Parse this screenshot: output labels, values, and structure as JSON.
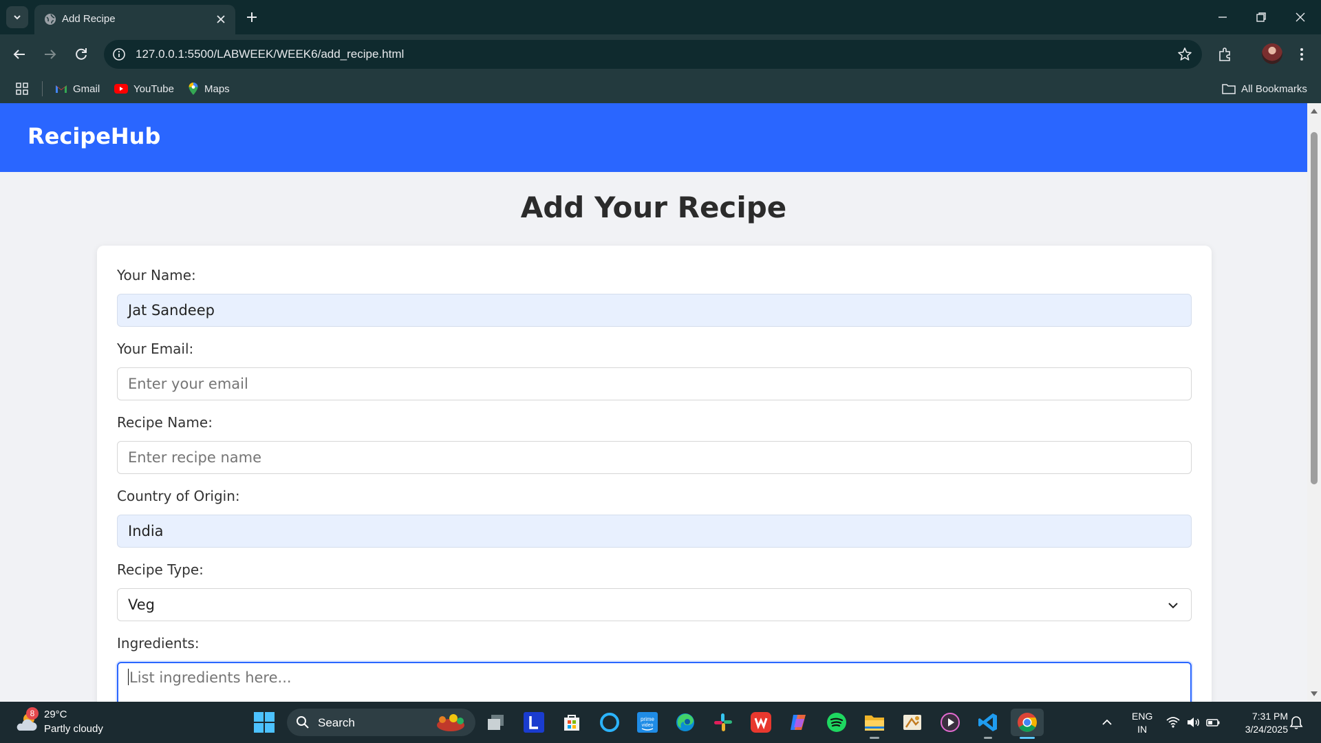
{
  "browser": {
    "tab_title": "Add Recipe",
    "url": "127.0.0.1:5500/LABWEEK/WEEK6/add_recipe.html",
    "bookmarks": [
      {
        "label": "Gmail",
        "icon": "gmail-icon"
      },
      {
        "label": "YouTube",
        "icon": "youtube-icon"
      },
      {
        "label": "Maps",
        "icon": "maps-icon"
      }
    ],
    "all_bookmarks_label": "All Bookmarks"
  },
  "site": {
    "brand": "RecipeHub",
    "page_title": "Add Your Recipe",
    "accent_color": "#2a66ff",
    "form": {
      "name": {
        "label": "Your Name:",
        "value": "Jat Sandeep"
      },
      "email": {
        "label": "Your Email:",
        "placeholder": "Enter your email"
      },
      "recipe_name": {
        "label": "Recipe Name:",
        "placeholder": "Enter recipe name"
      },
      "country": {
        "label": "Country of Origin:",
        "value": "India"
      },
      "recipe_type": {
        "label": "Recipe Type:",
        "value": "Veg"
      },
      "ingredients": {
        "label": "Ingredients:",
        "placeholder": "List ingredients here..."
      }
    }
  },
  "taskbar": {
    "weather": {
      "badge": "8",
      "temp": "29°C",
      "desc": "Partly cloudy"
    },
    "search_label": "Search",
    "apps": [
      "task-view-icon",
      "l-app-icon",
      "microsoft-store-icon",
      "cortana-icon",
      "prime-video-icon",
      "edge-icon",
      "slack-icon",
      "wps-office-icon",
      "copilot-icon",
      "spotify-icon",
      "file-explorer-icon",
      "snipping-icon",
      "media-player-icon",
      "vscode-icon",
      "chrome-icon"
    ],
    "lang_line1": "ENG",
    "lang_line2": "IN",
    "time": "7:31 PM",
    "date": "3/24/2025"
  }
}
